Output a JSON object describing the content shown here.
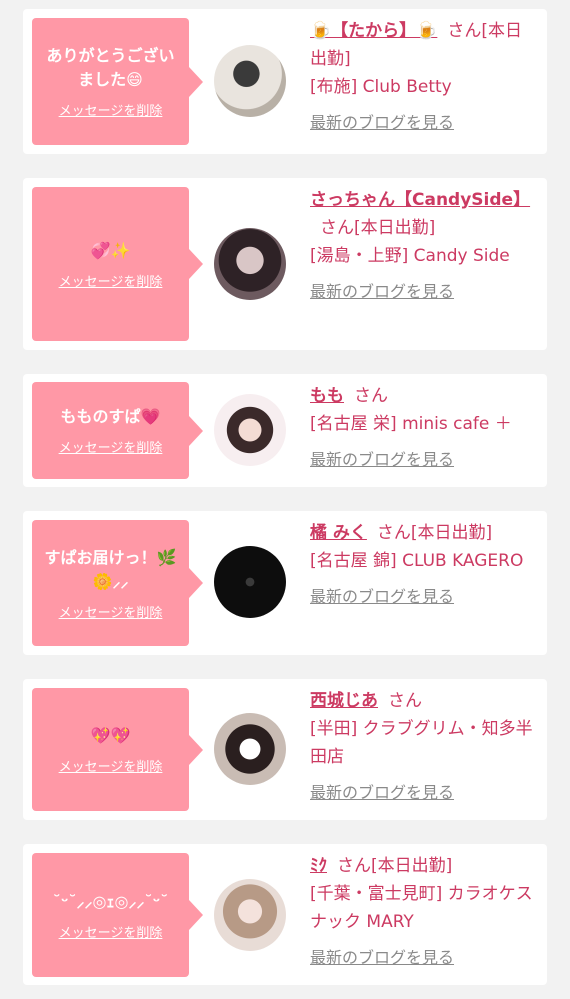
{
  "colors": {
    "background": "#f2f2f2",
    "card": "#ffffff",
    "bubble": "#ff98a6",
    "accent_text": "#cc3a62",
    "muted_text": "#8a8a8a"
  },
  "labels": {
    "delete_message": "メッセージを削除",
    "view_latest_blog": "最新のブログを見る"
  },
  "cards": [
    {
      "message": "ありがとうござい\nました😄",
      "name": "🍺【たから】🍺",
      "suffix": "さん[本日出勤]",
      "store": "[布施] Club Betty"
    },
    {
      "message": "💞✨",
      "name": "さっちゃん【CandySide】",
      "suffix": "さん[本日出勤]",
      "store": "[湯島・上野] Candy Side"
    },
    {
      "message": "もものすぱ💗",
      "name": "もも",
      "suffix": "さん",
      "store": "[名古屋 栄] minis cafe ＋"
    },
    {
      "message": "すぱお届けっ！🌿\n🌼⸝⸝",
      "name": "橘 みく",
      "suffix": "さん[本日出勤]",
      "store": "[名古屋 錦] CLUB KAGERO"
    },
    {
      "message": "💖💖",
      "name": "西城じあ",
      "suffix": "さん",
      "store": "[半田] クラブグリム・知多半田店"
    },
    {
      "message": "˘ᵕ˘⸝⸝◎ｪ◎⸝⸝˘ᵕ˘",
      "name": "ﾐｸ",
      "suffix": "さん[本日出勤]",
      "store": "[千葉・富士見町] カラオケスナック MARY"
    }
  ]
}
